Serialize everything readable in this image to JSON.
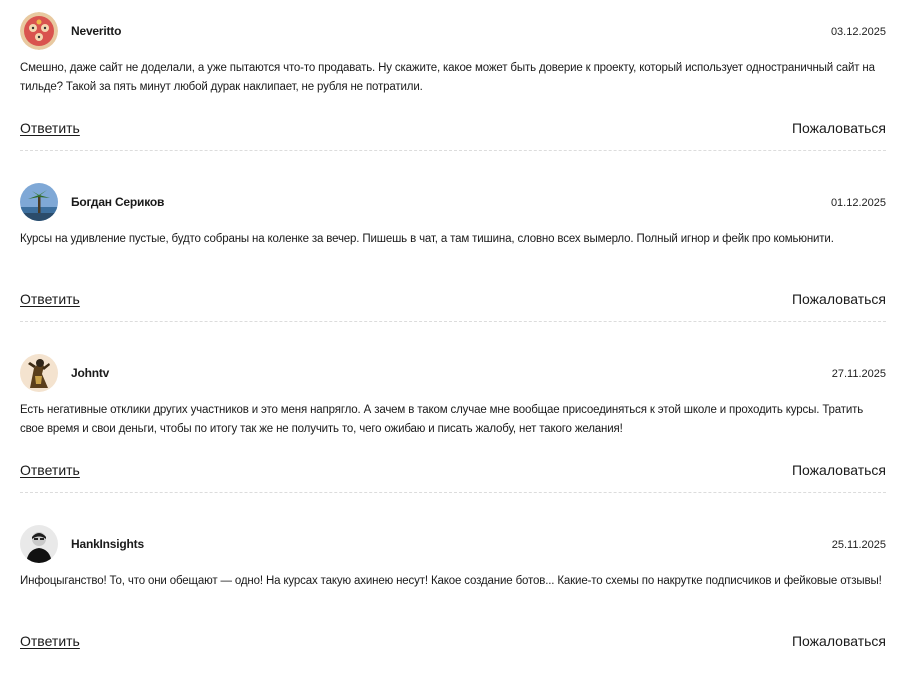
{
  "comments": [
    {
      "author": "Neveritto",
      "date": "03.12.2025",
      "text": "Смешно, даже сайт не доделали, а уже пытаются что-то продавать. Ну скажите, какое может быть доверие к проекту, который использует одностраничный сайт на тильде? Такой за пять минут любой дурак наклипает, не рубля не потратили.",
      "reply_label": "Ответить",
      "report_label": "Пожаловаться",
      "avatar_icon": "cartoon-avatar-icon"
    },
    {
      "author": "Богдан Сериков",
      "date": "01.12.2025",
      "text": "Курсы на удивление пустые, будто собраны на коленке за вечер. Пишешь в чат, а там тишина, словно всех вымерло. Полный игнор и фейк про комьюнити.",
      "reply_label": "Ответить",
      "report_label": "Пожаловаться",
      "avatar_icon": "palm-tree-avatar-icon"
    },
    {
      "author": "Johntv",
      "date": "27.11.2025",
      "text": "Есть негативные отклики других участников и это меня напрягло. А зачем в таком случае мне вообщае присоединяться к этой школе и проходить курсы. Тратить свое время и свои деньги, чтобы по итогу так же не получить то, чего ожибаю и писать жалобу, нет такого желания!",
      "reply_label": "Ответить",
      "report_label": "Пожаловаться",
      "avatar_icon": "figure-avatar-icon"
    },
    {
      "author": "HankInsights",
      "date": "25.11.2025",
      "text": "Инфоцыганство! То, что они обещают — одно! На курсах такую ахинею несут! Какое создание ботов... Какие-то схемы по накрутке подписчиков и фейковые отзывы!",
      "reply_label": "Ответить",
      "report_label": "Пожаловаться",
      "avatar_icon": "person-photo-avatar-icon"
    }
  ]
}
